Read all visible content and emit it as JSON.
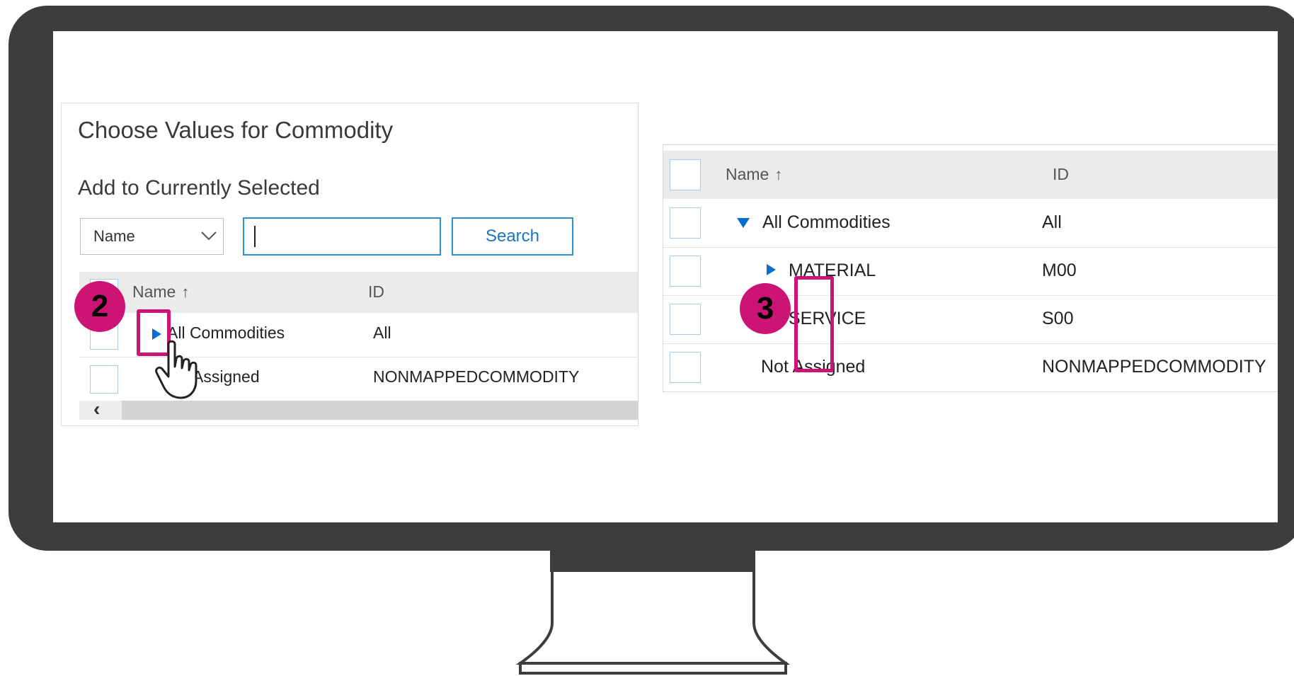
{
  "left_dialog": {
    "title": "Choose Values for Commodity",
    "section_title": "Add to Currently Selected",
    "search_field_select": "Name",
    "search_input_value": "",
    "search_button": "Search",
    "table": {
      "col_name": "Name",
      "col_id": "ID",
      "sort_icon": "arrow-up-icon",
      "rows": [
        {
          "name": "All Commodities",
          "id": "All"
        },
        {
          "name": "Assigned",
          "id": "NONMAPPEDCOMMODITY"
        }
      ]
    },
    "step_badge": "2"
  },
  "right_dialog": {
    "table": {
      "col_name": "Name",
      "col_id": "ID",
      "rows": [
        {
          "name": "All Commodities",
          "id": "All"
        },
        {
          "name": "MATERIAL",
          "id": "M00"
        },
        {
          "name": "SERVICE",
          "id": "S00"
        },
        {
          "name": "Not Assigned",
          "id": "NONMAPPEDCOMMODITY"
        }
      ]
    },
    "step_badge": "3"
  },
  "colors": {
    "highlight": "#cc1475",
    "accent": "#0a6ed1",
    "monitor": "#3d3d3d"
  }
}
